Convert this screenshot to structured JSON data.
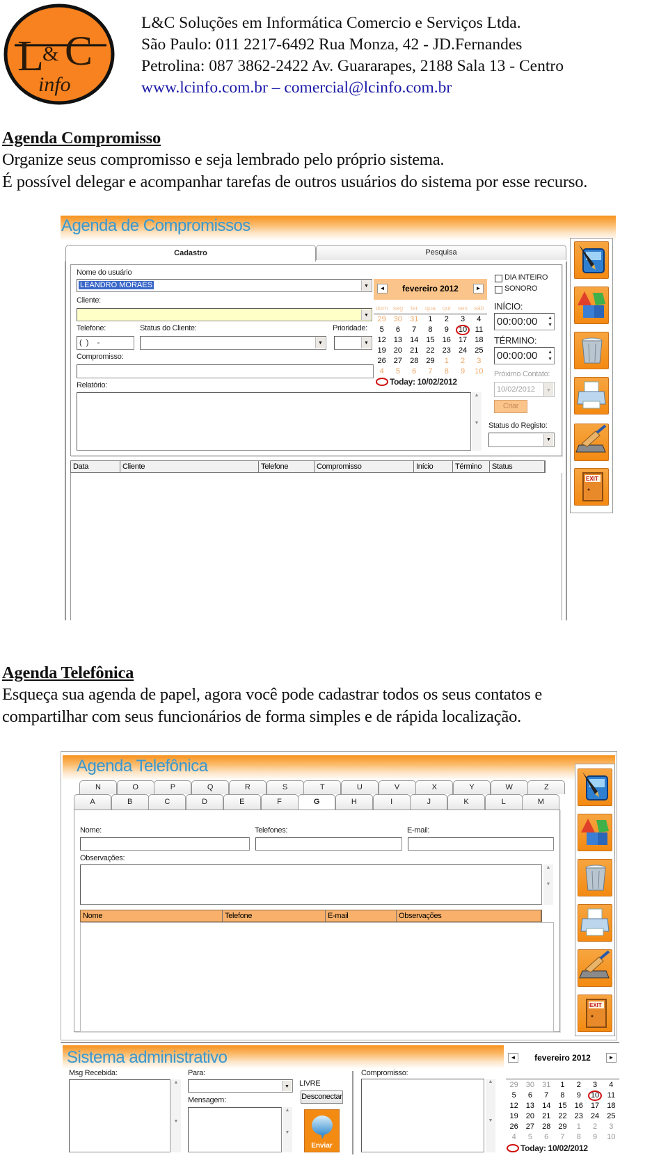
{
  "company": {
    "logo_text": {
      "l": "L",
      "amp": "&",
      "c": "C",
      "info": "info"
    },
    "name": "L&C Soluções em Informática Comercio e Serviços Ltda.",
    "sao_paulo": "São Paulo: 011 2217-6492 Rua Monza, 42  -  JD.Fernandes",
    "petrolina": "Petrolina:   087 3862-2422 Av. Guararapes, 2188 Sala 13 - Centro",
    "website": "www.lcinfo.com.br",
    "separator": " – ",
    "email": "comercial@lcinfo.com.br",
    "logo_color": "#f7821f"
  },
  "section1": {
    "heading": "Agenda Compromisso",
    "lines": [
      "Organize seus compromisso e seja lembrado pelo próprio sistema.",
      "É possível delegar e acompanhar tarefas de outros usuários do sistema por esse recurso."
    ]
  },
  "app1": {
    "title": "Agenda de Compromissos",
    "tabs": [
      "Cadastro",
      "Pesquisa"
    ],
    "active_tab": "Cadastro",
    "user_label": "Nome do usuário",
    "user_value": "LEANDRO MORAES",
    "client_label": "Cliente:",
    "phone_label": "Telefone:",
    "phone_value": "(  )    -",
    "client_status_label": "Status do Cliente:",
    "priority_label": "Prioridade:",
    "appointment_label": "Compromisso:",
    "report_label": "Relatório:",
    "all_day_label": "DIA INTEIRO",
    "sound_label": "SONORO",
    "start_label": "INÍCIO:",
    "start_value": "00:00:00",
    "end_label": "TÉRMINO:",
    "end_value": "00:00:00",
    "next_contact_label": "Próximo Contato:",
    "next_contact_value": "10/02/2012",
    "create_button": "Criar",
    "record_status_label": "Status do Registo:",
    "calendar": {
      "month": "fevereiro 2012",
      "day_names": [
        "dom",
        "seg",
        "ter",
        "qua",
        "qui",
        "sex",
        "sáb"
      ],
      "weeks": [
        [
          29,
          30,
          31,
          1,
          2,
          3,
          4
        ],
        [
          5,
          6,
          7,
          8,
          9,
          10,
          11
        ],
        [
          12,
          13,
          14,
          15,
          16,
          17,
          18
        ],
        [
          19,
          20,
          21,
          22,
          23,
          24,
          25
        ],
        [
          26,
          27,
          28,
          29,
          1,
          2,
          3
        ],
        [
          4,
          5,
          6,
          7,
          8,
          9,
          10
        ]
      ],
      "selected_day": 10,
      "today_label": "Today: 10/02/2012"
    },
    "table_columns": [
      "Data",
      "Cliente",
      "Telefone",
      "Compromisso",
      "Início",
      "Término",
      "Status"
    ],
    "sidebar_icons": [
      "edit-pen-icon",
      "new-shapes-icon",
      "trash-icon",
      "printer-icon",
      "clear-brush-icon",
      "exit-door-icon"
    ],
    "exit_label": "EXIT"
  },
  "section2": {
    "heading": "Agenda Telefônica",
    "lines": [
      "Esqueça sua agenda de papel, agora você pode cadastrar todos os seus contatos e",
      "compartilhar com seus funcionários de forma simples e de rápida localização."
    ]
  },
  "app2": {
    "title": "Agenda Telefônica",
    "tabs_row1": [
      "N",
      "O",
      "P",
      "Q",
      "R",
      "S",
      "T",
      "U",
      "V",
      "X",
      "Y",
      "W",
      "Z"
    ],
    "tabs_row2": [
      "A",
      "B",
      "C",
      "D",
      "E",
      "F",
      "G",
      "H",
      "I",
      "J",
      "K",
      "L",
      "M"
    ],
    "active_tab": "G",
    "name_label": "Nome:",
    "phones_label": "Telefones:",
    "email_label": "E-mail:",
    "notes_label": "Observações:",
    "table_columns": [
      "Nome",
      "Telefone",
      "E-mail",
      "Observações"
    ],
    "sidebar_icons": [
      "edit-pen-icon",
      "new-shapes-icon",
      "trash-icon",
      "printer-icon",
      "clear-brush-icon",
      "exit-door-icon"
    ],
    "exit_label": "EXIT"
  },
  "admin": {
    "title": "Sistema administrativo",
    "msg_received_label": "Msg Recebida:",
    "to_label": "Para:",
    "status": "LIVRE",
    "disconnect_button": "Desconectar",
    "message_label": "Mensagem:",
    "send_button": "Enviar",
    "appointment_label": "Compromisso:",
    "calendar": {
      "month": "fevereiro 2012",
      "weeks": [
        [
          29,
          30,
          31,
          1,
          2,
          3,
          4
        ],
        [
          5,
          6,
          7,
          8,
          9,
          10,
          11
        ],
        [
          12,
          13,
          14,
          15,
          16,
          17,
          18
        ],
        [
          19,
          20,
          21,
          22,
          23,
          24,
          25
        ],
        [
          26,
          27,
          28,
          29,
          1,
          2,
          3
        ],
        [
          4,
          5,
          6,
          7,
          8,
          9,
          10
        ]
      ],
      "selected_day": 10,
      "today_label": "Today: 10/02/2012"
    }
  },
  "colors": {
    "brand_orange": "#f7921e",
    "title_blue": "#3f97c9",
    "highlight_yellow": "#ffffc8",
    "table_header_orange": "#f8b06a",
    "today_red": "#d01010"
  }
}
